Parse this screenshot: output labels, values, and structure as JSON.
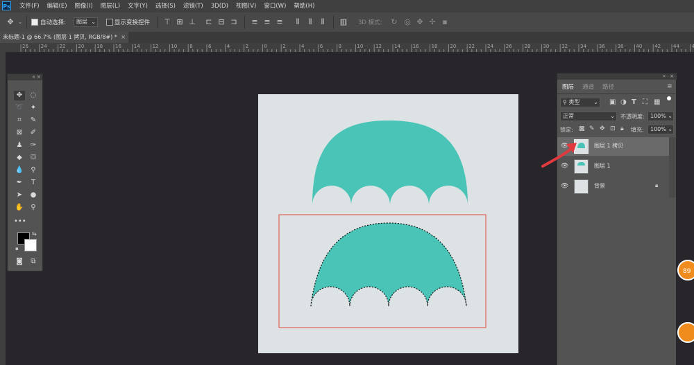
{
  "app": {
    "logo": "Ps"
  },
  "menu": [
    "文件(F)",
    "编辑(E)",
    "图像(I)",
    "图层(L)",
    "文字(Y)",
    "选择(S)",
    "滤镜(T)",
    "3D(D)",
    "视图(V)",
    "窗口(W)",
    "帮助(H)"
  ],
  "options": {
    "auto_select_label": "自动选择:",
    "auto_select_value": "图层",
    "transform_label": "显示变换控件",
    "mode_3d_label": "3D 模式:"
  },
  "document_tab": {
    "title": "未标题-1 @ 66.7% (图层 1 拷贝, RGB/8#) *",
    "close": "×"
  },
  "ruler_ticks": [
    "26",
    "24",
    "22",
    "20",
    "18",
    "16",
    "14",
    "12",
    "10",
    "8",
    "6",
    "4",
    "2",
    "0",
    "2",
    "4",
    "6",
    "8",
    "10",
    "12",
    "14",
    "16",
    "18",
    "20",
    "22",
    "24",
    "26",
    "28",
    "30",
    "32",
    "34",
    "36",
    "38",
    "40",
    "42",
    "44",
    "46"
  ],
  "panel_controls": {
    "collapse": "«",
    "close": "×",
    "menu": "≡"
  },
  "tools_icons": [
    "move-icon",
    "marquee-ellipse-icon",
    "lasso-icon",
    "magic-wand-icon",
    "crop-icon",
    "eyedropper-icon",
    "frame-icon",
    "brush-icon",
    "stamp-icon",
    "history-brush-icon",
    "eraser-icon",
    "paint-bucket-icon",
    "blur-icon",
    "dodge-icon",
    "pen-icon",
    "type-icon",
    "path-select-icon",
    "ellipse-icon",
    "hand-icon",
    "zoom-icon",
    "more-icon"
  ],
  "layers_panel": {
    "tabs": [
      "图层",
      "通道",
      "路径"
    ],
    "filter_label": "类型",
    "blend_mode": "正常",
    "opacity_label": "不透明度:",
    "opacity_value": "100%",
    "lock_label": "锁定:",
    "fill_label": "填充:",
    "fill_value": "100%",
    "layers": [
      {
        "name": "图层 1 拷贝",
        "selected": true
      },
      {
        "name": "图层 1",
        "selected": false
      },
      {
        "name": "背景",
        "selected": false,
        "locked": true
      }
    ]
  },
  "badge_text": "89",
  "colors": {
    "umbrella": "#49c4b7",
    "canvas": "#dde2e5",
    "selection_box": "#e14b3a",
    "arrow": "#e0393e"
  }
}
